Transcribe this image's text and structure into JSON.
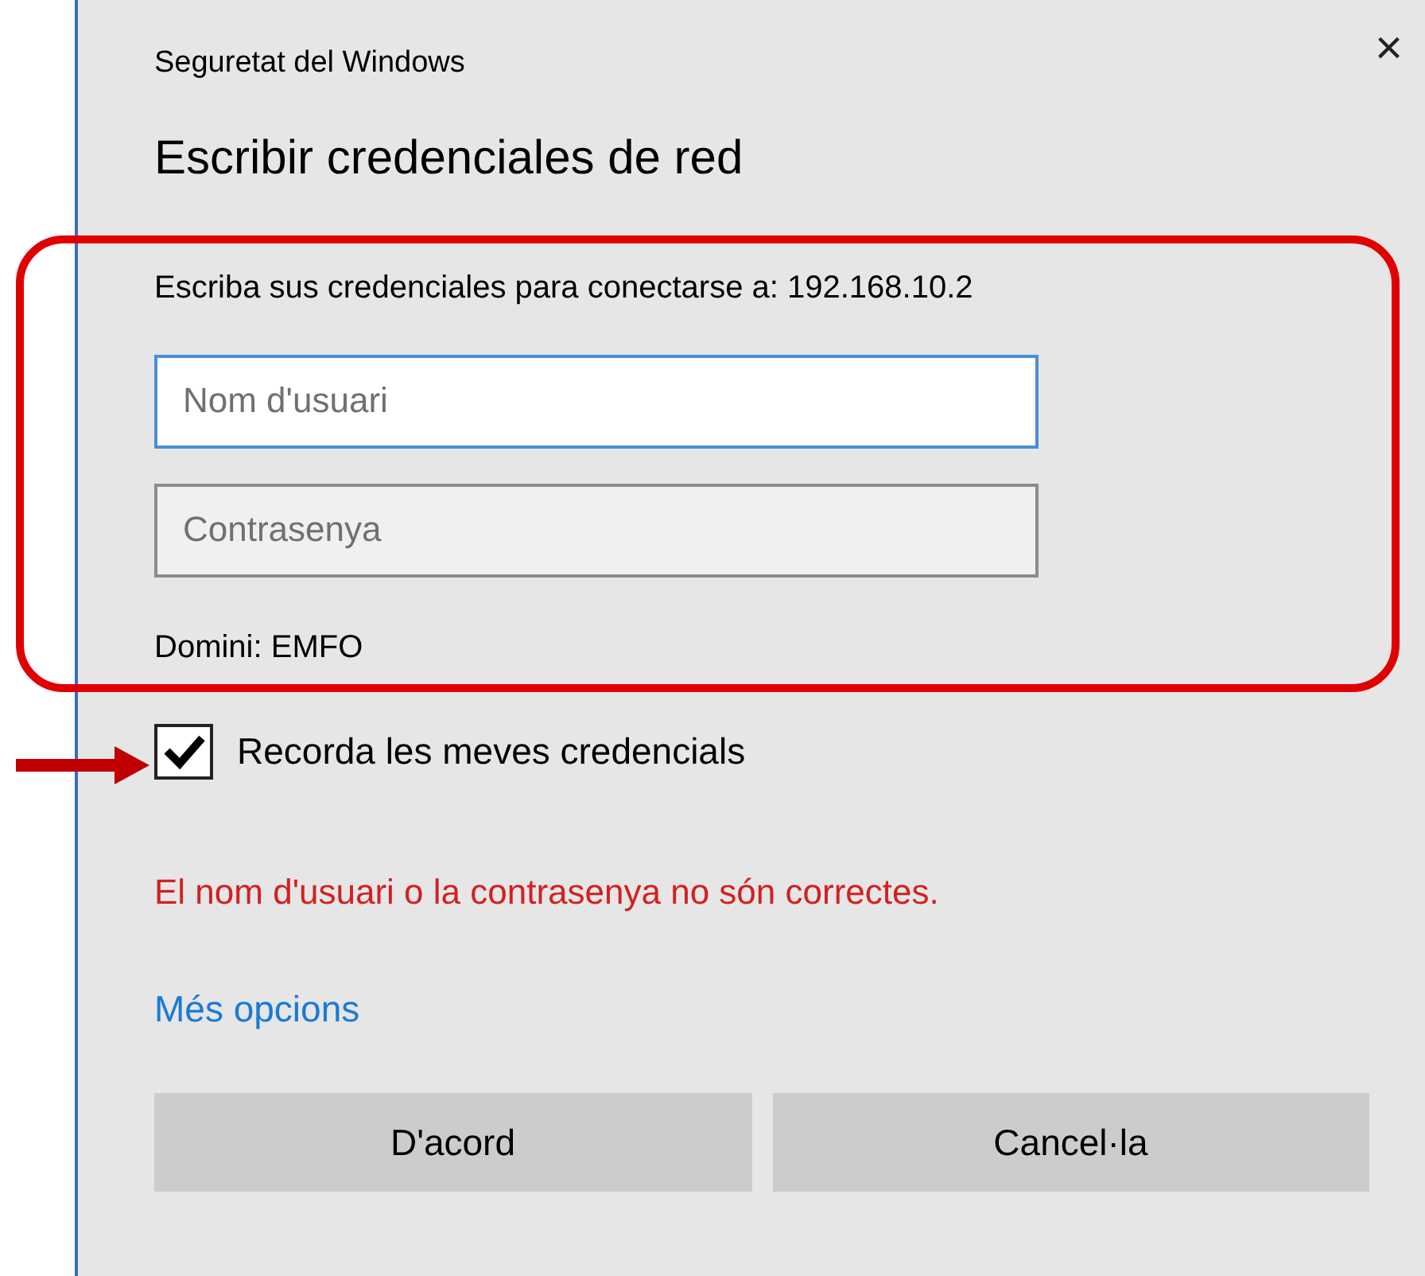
{
  "window": {
    "title": "Seguretat del Windows",
    "close": "×"
  },
  "heading": "Escribir credenciales de red",
  "prompt": "Escriba sus credenciales para conectarse a: 192.168.10.2",
  "fields": [
    {
      "placeholder": "Nom d'usuari",
      "focused": true
    },
    {
      "placeholder": "Contrasenya",
      "focused": false
    }
  ],
  "domain": "Domini: EMFO",
  "remember": {
    "label": "Recorda les meves credencials",
    "checked": true,
    "arrow_marked": true
  },
  "error": "El nom d'usuari o la contrasenya no són correctes.",
  "more_link": "Més opcions",
  "buttons": [
    "D'acord",
    "Cancel·la"
  ],
  "credentials_highlighted": true
}
